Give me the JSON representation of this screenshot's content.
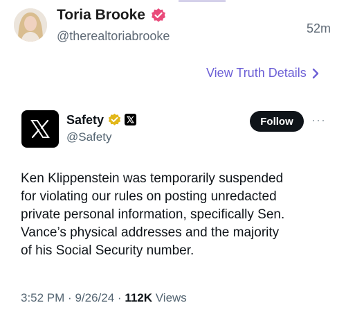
{
  "post": {
    "author_name": "Toria Brooke",
    "author_handle": "@therealtoriabrooke",
    "time_ago": "52m",
    "view_details_label": "View Truth Details"
  },
  "embedded_tweet": {
    "name": "Safety",
    "handle": "@Safety",
    "follow_label": "Follow",
    "more_label": "···",
    "text": "Ken Klippenstein was temporarily suspended\nfor violating our rules on posting unredacted\nprivate personal information, specifically Sen.\nVance’s physical addresses and the majority\nof his Social Security number.",
    "time": "3:52 PM",
    "date": "9/26/24",
    "views_count": "112K",
    "views_label": "Views",
    "separator": "·"
  },
  "icons": {
    "author_badge": "verified-pink-badge-icon",
    "gold_badge": "verified-gold-badge-icon",
    "x_logo": "x-logo-icon",
    "chevron": "chevron-right-icon"
  },
  "colors": {
    "accent": "#6c5fd6",
    "pink_badge": "#e94a7a",
    "gold_badge": "#e2b719",
    "follow_bg": "#0f1419"
  }
}
